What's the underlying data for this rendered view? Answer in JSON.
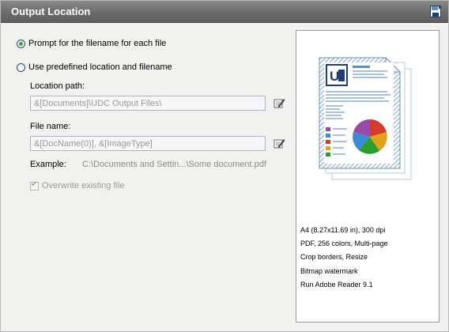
{
  "header": {
    "title": "Output Location",
    "icon": "save-disk-icon"
  },
  "options": {
    "prompt_label": "Prompt for the filename for each file",
    "predefined_label": "Use predefined location and filename",
    "selected": "prompt"
  },
  "location": {
    "label": "Location path:",
    "value": "&[Documents]\\UDC Output Files\\"
  },
  "filename": {
    "label": "File name:",
    "value": "&[DocName(0)], &[ImageType]"
  },
  "example": {
    "label": "Example:",
    "value": "C:\\Documents and Settin...\\Some document.pdf"
  },
  "overwrite": {
    "label": "Overwrite existing file",
    "checked": true,
    "enabled": false
  },
  "preview": {
    "icon": "document-pie-chart-icon",
    "summary": [
      "A4 (8.27x11.69 in), 300 dpi",
      "PDF, 256 colors, Multi-page",
      "Crop borders, Resize",
      "Bitmap watermark",
      "Run Adobe Reader 9.1"
    ]
  }
}
